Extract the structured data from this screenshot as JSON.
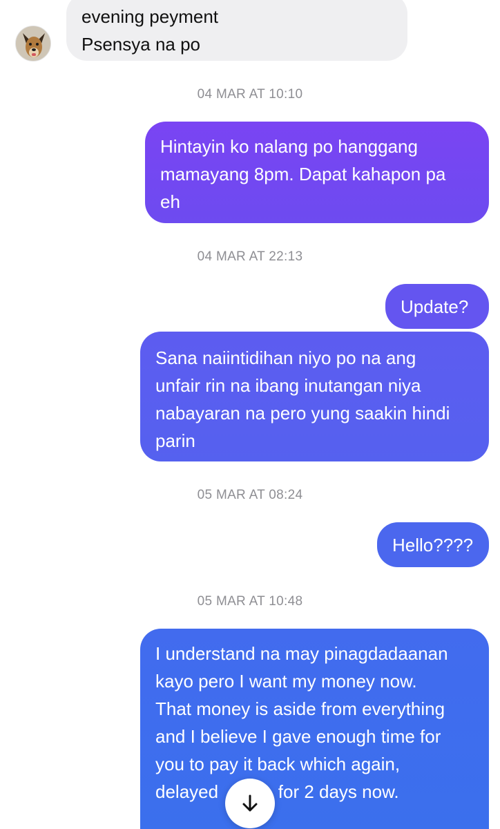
{
  "incoming": {
    "lines": [
      "evening peyment",
      "Psensya na po"
    ],
    "avatar_icon": "dog-avatar-icon"
  },
  "timestamps": [
    "04 MAR AT 10:10",
    "04 MAR AT 22:13",
    "05 MAR AT 08:24",
    "05 MAR AT 10:48"
  ],
  "outgoing": [
    {
      "lines": [
        "Hintayin ko nalang po hanggang",
        "mamayang 8pm. Dapat kahapon pa",
        "eh"
      ]
    },
    {
      "lines": [
        "Update?"
      ]
    },
    {
      "lines": [
        "Sana naiintidihan niyo po na ang",
        "unfair rin na ibang inutangan niya",
        "nabayaran na pero yung saakin hindi",
        "parin"
      ]
    },
    {
      "lines": [
        "Hello????"
      ]
    },
    {
      "lines": [
        "I understand na may pinagdadaanan",
        "kayo pero I want my money now.",
        "That money is aside from everything",
        "and I believe I gave enough time for",
        "you to pay it back which again,",
        "delayed            for 2 days now."
      ]
    }
  ],
  "scroll_button": {
    "icon": "arrow-down-icon"
  },
  "colors": {
    "incoming_bubble": "#efeff1",
    "outgoing_purple": "#7a44f3",
    "outgoing_blue": "#3a70ed",
    "timestamp": "#8e8e93"
  }
}
